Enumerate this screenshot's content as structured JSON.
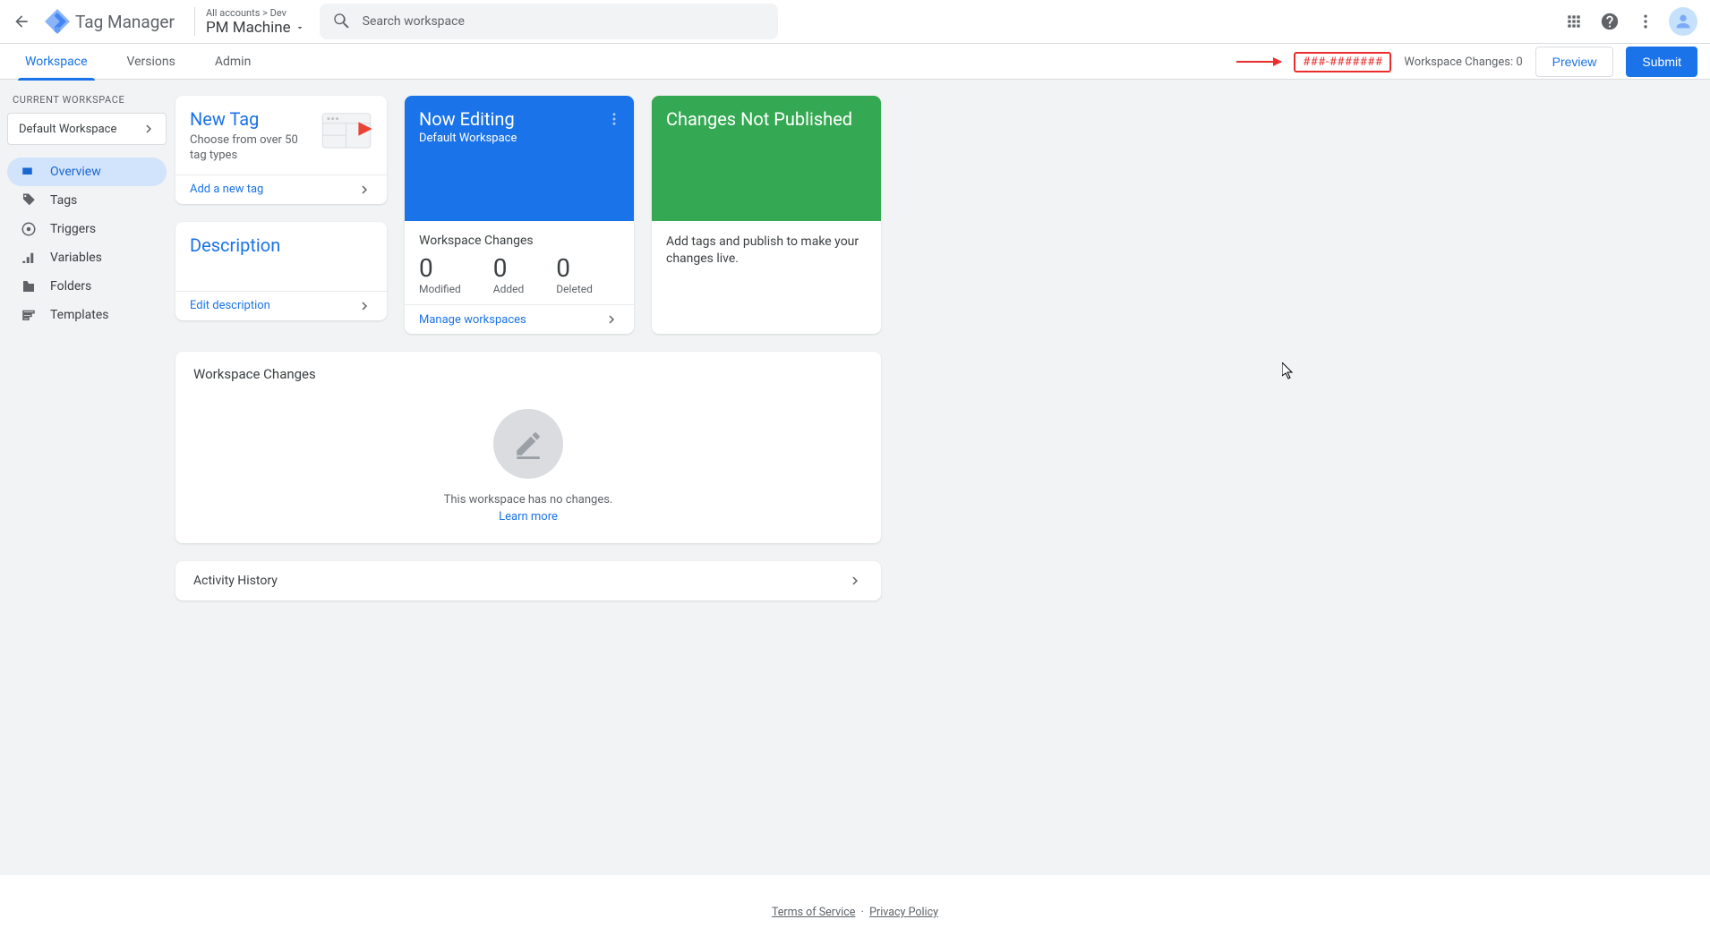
{
  "header": {
    "product": "Tag Manager",
    "crumb": "All accounts > Dev",
    "account": "PM Machine",
    "search_placeholder": "Search workspace"
  },
  "tabs": [
    "Workspace",
    "Versions",
    "Admin"
  ],
  "container_id": "###-#######",
  "ws_changes_label": "Workspace Changes: 0",
  "preview_btn": "Preview",
  "submit_btn": "Submit",
  "sidebar": {
    "label": "CURRENT WORKSPACE",
    "selector": "Default Workspace",
    "items": [
      {
        "label": "Overview"
      },
      {
        "label": "Tags"
      },
      {
        "label": "Triggers"
      },
      {
        "label": "Variables"
      },
      {
        "label": "Folders"
      },
      {
        "label": "Templates"
      }
    ]
  },
  "newtag": {
    "title": "New Tag",
    "subtitle": "Choose from over 50 tag types",
    "action": "Add a new tag"
  },
  "desc": {
    "title": "Description",
    "action": "Edit description"
  },
  "editing": {
    "title": "Now Editing",
    "subtitle": "Default Workspace",
    "midtitle": "Workspace Changes",
    "stats": [
      {
        "n": "0",
        "l": "Modified"
      },
      {
        "n": "0",
        "l": "Added"
      },
      {
        "n": "0",
        "l": "Deleted"
      }
    ],
    "action": "Manage workspaces"
  },
  "publish": {
    "title": "Changes Not Published",
    "msg": "Add tags and publish to make your changes live."
  },
  "changes": {
    "title": "Workspace Changes",
    "empty": "This workspace has no changes.",
    "learn": "Learn more"
  },
  "history": "Activity History",
  "footer": {
    "terms": "Terms of Service",
    "privacy": "Privacy Policy"
  }
}
